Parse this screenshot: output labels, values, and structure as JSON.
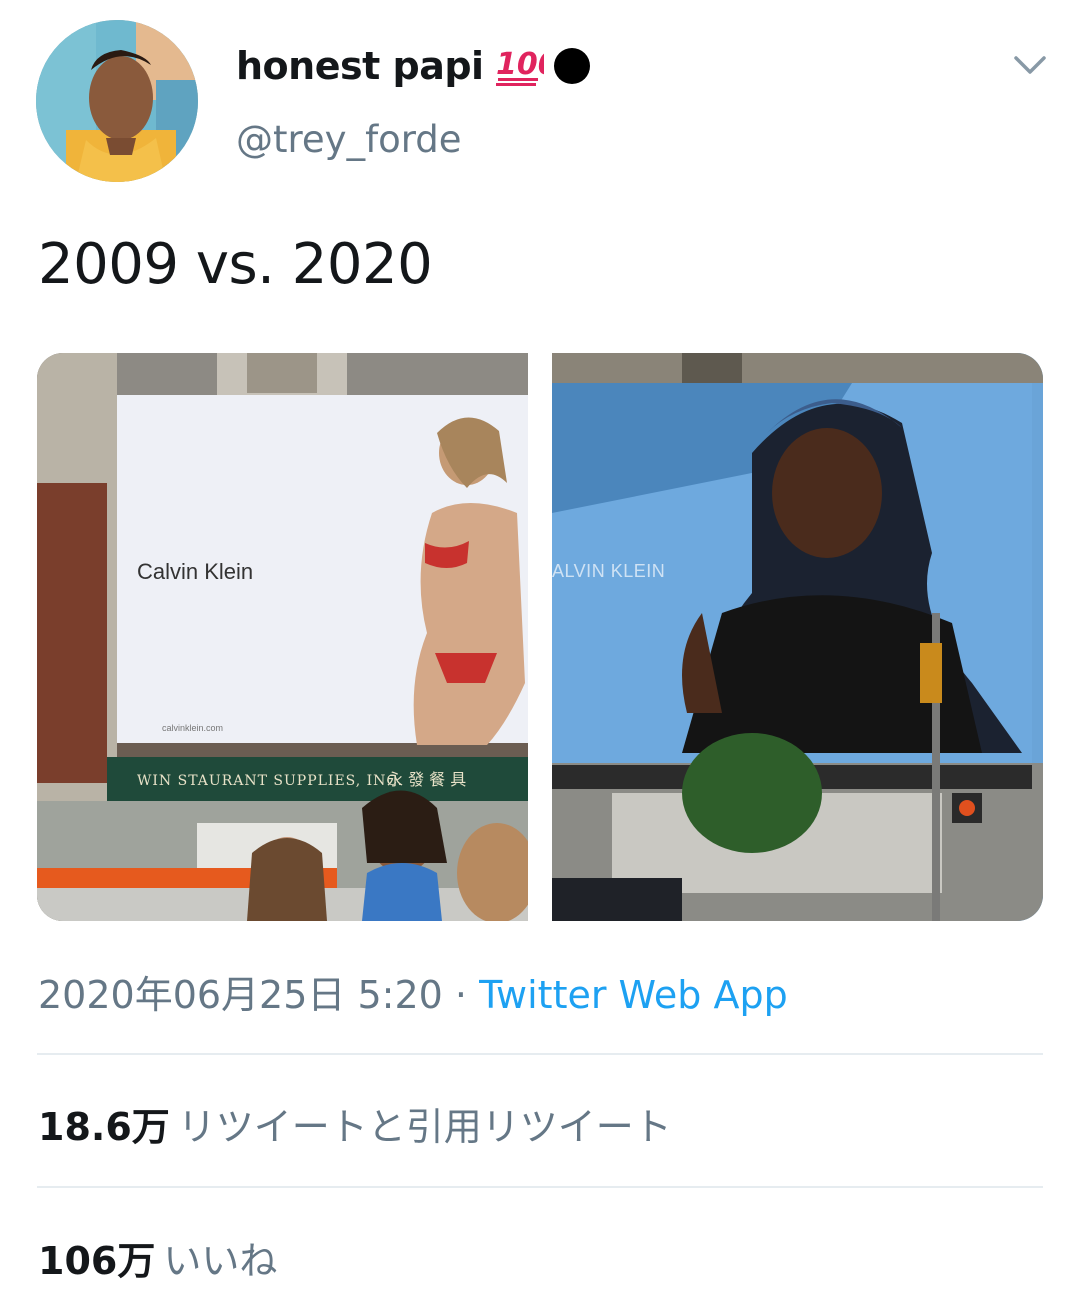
{
  "user": {
    "display_name": "honest papi",
    "emoji": "💯",
    "handle": "@trey_forde"
  },
  "tweet": {
    "text": "2009 vs. 2020"
  },
  "media": {
    "left": {
      "brand": "Calvin Klein",
      "url_text": "calvinklein.com",
      "store_sign": "WIN  STAURANT SUPPLIES, INC.",
      "chinese_sign": "永 發 餐 具"
    },
    "right": {
      "brand": "ALVIN KLEIN"
    }
  },
  "meta": {
    "timestamp": "2020年06月25日 5:20",
    "separator": "·",
    "source": "Twitter Web App"
  },
  "stats": {
    "retweets_count": "18.6万",
    "retweets_label": "リツイートと引用リツイート",
    "likes_count": "106万",
    "likes_label": "いいね"
  },
  "colors": {
    "accent": "#1da1f2",
    "secondary_text": "#657786",
    "primary_text": "#14171a",
    "divider": "#e6ecf0"
  }
}
